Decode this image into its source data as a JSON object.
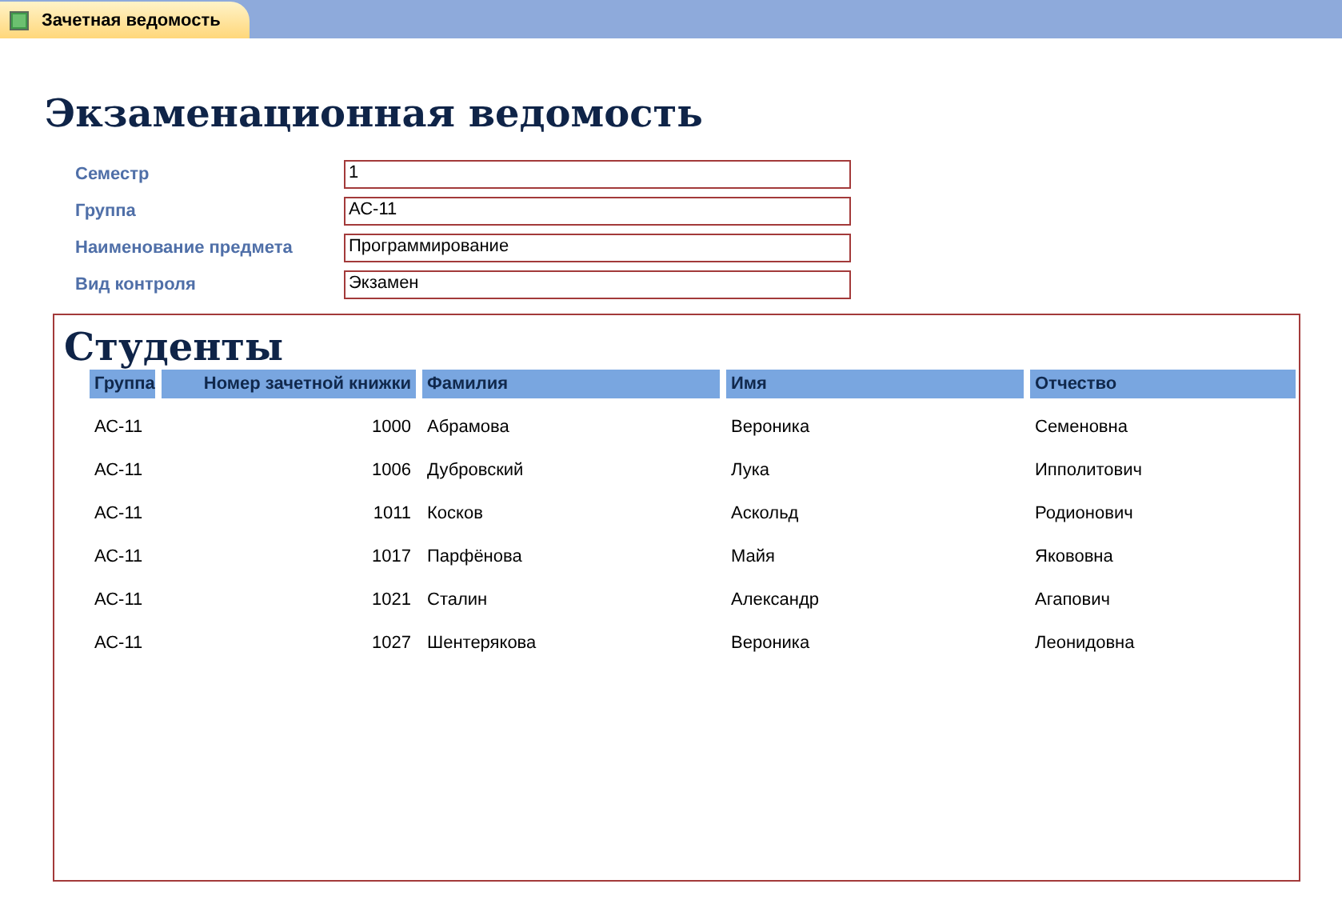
{
  "tabs": [
    {
      "label": "Зачетная ведомость",
      "selected": true
    }
  ],
  "title": "Экзаменационная ведомость",
  "fields": [
    {
      "label": "Семестр",
      "value": "1"
    },
    {
      "label": "Группа",
      "value": "АС-11"
    },
    {
      "label": "Наименование предмета",
      "value": "Программирование"
    },
    {
      "label": "Вид контроля",
      "value": "Экзамен"
    }
  ],
  "subform": {
    "title": "Студенты",
    "columns": [
      {
        "label": "Группа",
        "kind": "text"
      },
      {
        "label": "Номер зачетной книжки",
        "kind": "number"
      },
      {
        "label": "Фамилия",
        "kind": "text"
      },
      {
        "label": "Имя",
        "kind": "text"
      },
      {
        "label": "Отчество",
        "kind": "text"
      }
    ],
    "rows": [
      [
        "АС-11",
        "1000",
        "Абрамова",
        "Вероника",
        "Семеновна"
      ],
      [
        "АС-11",
        "1006",
        "Дубровский",
        "Лука",
        "Ипполитович"
      ],
      [
        "АС-11",
        "1011",
        "Косков",
        "Аскольд",
        "Родионович"
      ],
      [
        "АС-11",
        "1017",
        "Парфёнова",
        "Майя",
        "Якововна"
      ],
      [
        "АС-11",
        "1021",
        "Сталин",
        "Александр",
        "Агапович"
      ],
      [
        "АС-11",
        "1027",
        "Шентерякова",
        "Вероника",
        "Леонидовна"
      ]
    ]
  }
}
